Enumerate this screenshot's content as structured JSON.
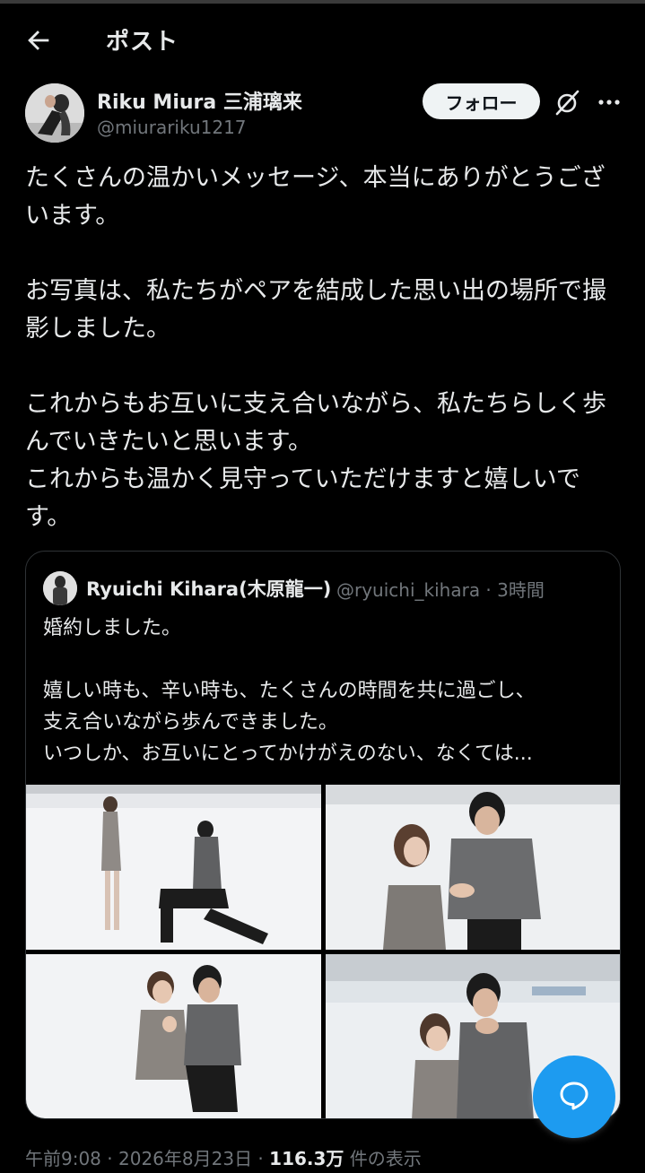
{
  "header": {
    "title": "ポスト",
    "back_icon": "arrow-left-icon"
  },
  "post": {
    "author_name": "Riku Miura 三浦璃来",
    "author_handle": "@miurariku1217",
    "follow_label": "フォロー",
    "text": "たくさんの温かいメッセージ、本当にありがとうございます。\n\nお写真は、私たちがペアを結成した思い出の場所で撮影しました。\n\nこれからもお互いに支え合いながら、私たちらしく歩んでいきたいと思います。\nこれからも温かく見守っていただけますと嬉しいです。"
  },
  "quote": {
    "author_name": "Ryuichi Kihara(木原龍一)",
    "author_handle": "@ryuichi_kihara",
    "time": "3時間",
    "text": "婚約しました。\n\n嬉しい時も、辛い時も、たくさんの時間を共に過ごし、\n支え合いながら歩んできました。\nいつしか、お互いにとってかけがえのない、なくては..."
  },
  "footer": {
    "time": "午前9:08",
    "date": "2026年8月23日",
    "views": "116.3万",
    "views_label": "件の表示"
  },
  "colors": {
    "accent": "#1d9bf0",
    "muted": "#71767b",
    "text": "#e7e9ea",
    "background": "#000000"
  }
}
